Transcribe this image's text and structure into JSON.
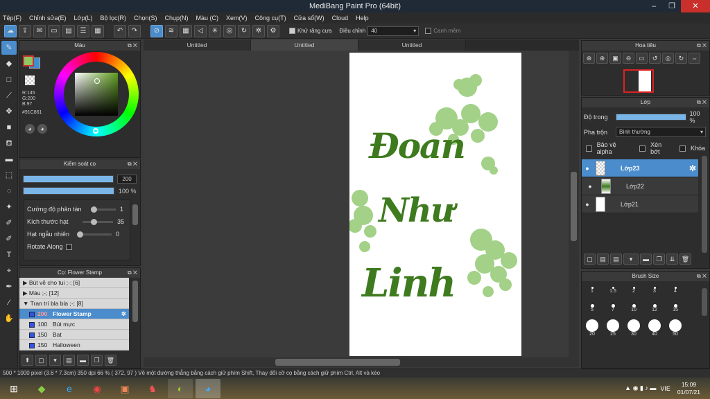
{
  "app": {
    "title": "MediBang Paint Pro (64bit)"
  },
  "menu": [
    "Tệp(F)",
    "Chỉnh sửa(E)",
    "Lớp(L)",
    "Bộ lọc(R)",
    "Chọn(S)",
    "Chụp(N)",
    "Màu (C)",
    "Xem(V)",
    "Công cụ(T)",
    "Cửa sổ(W)",
    "Cloud",
    "Help"
  ],
  "toolbar": {
    "antialias_label": "Khử răng cưa",
    "adjust_label": "Điều chỉnh",
    "adjust_value": "40",
    "snap_label": "Canh mềm"
  },
  "color_panel": {
    "title": "Màu",
    "r": "R:145",
    "g": "G:200",
    "b": "B:97",
    "hex": "#91C861",
    "colors": {
      "primary": "#91C861",
      "secondary": "#3f8ed0"
    }
  },
  "brush_control": {
    "title": "Kiểm soát cọ",
    "size": "200",
    "opacity": "100 %",
    "params": [
      {
        "label": "Cường độ phân tán",
        "value": "1"
      },
      {
        "label": "Kích thước hạt",
        "value": "35"
      },
      {
        "label": "Hạt ngẫu nhiên",
        "value": "0"
      },
      {
        "label": "Rotate Along",
        "value": ""
      }
    ]
  },
  "brush_list": {
    "title": "Cọ: Flower Stamp",
    "groups": [
      {
        "label": "Bút vẽ cho tui ;-; [6]"
      },
      {
        "label": "Màu ;-; [12]"
      },
      {
        "label": "Tran trí bla bla ;-; [8]"
      }
    ],
    "items": [
      {
        "size": "200",
        "name": "Flower Stamp"
      },
      {
        "size": "100",
        "name": "Bút mực"
      },
      {
        "size": "150",
        "name": "Bat"
      },
      {
        "size": "150",
        "name": "Halloween"
      }
    ]
  },
  "tabs": [
    "Untitled",
    "Untitled",
    "Untitled"
  ],
  "navigator": {
    "title": "Hoa tiêu"
  },
  "layer_panel": {
    "title": "Lớp",
    "opacity_label": "Độ trong",
    "opacity_value": "100 %",
    "blend_label": "Pha trộn",
    "blend_value": "Bình thường",
    "protect_alpha": "Bảo vệ alpha",
    "clipping": "Xén bớt",
    "lock": "Khóa",
    "layers": [
      "Lớp23",
      "Lớp22",
      "Lớp21"
    ]
  },
  "brush_size": {
    "title": "Brush Size",
    "sizes": [
      "1",
      "1.5",
      "2",
      "3",
      "4",
      "5",
      "7",
      "10",
      "12",
      "15",
      "20",
      "25",
      "30",
      "40",
      "50"
    ]
  },
  "status": {
    "text": "500 * 1000 pixel   (3.6 * 7.3cm)   350 dpi   66 %   ( 372, 97 )   Vẽ một đường thẳng bằng cách giữ phím Shift, Thay đổi cỡ cọ bằng cách giữ phím Ctrl, Alt và kéo"
  },
  "taskbar": {
    "lang": "VIE",
    "time": "15:09",
    "date": "01/07/21"
  },
  "canvas": {
    "lettering": [
      "Đoan",
      "Như",
      "Linh"
    ],
    "ink_color": "#3e7a1e",
    "flower_color": "#8cc66a"
  }
}
